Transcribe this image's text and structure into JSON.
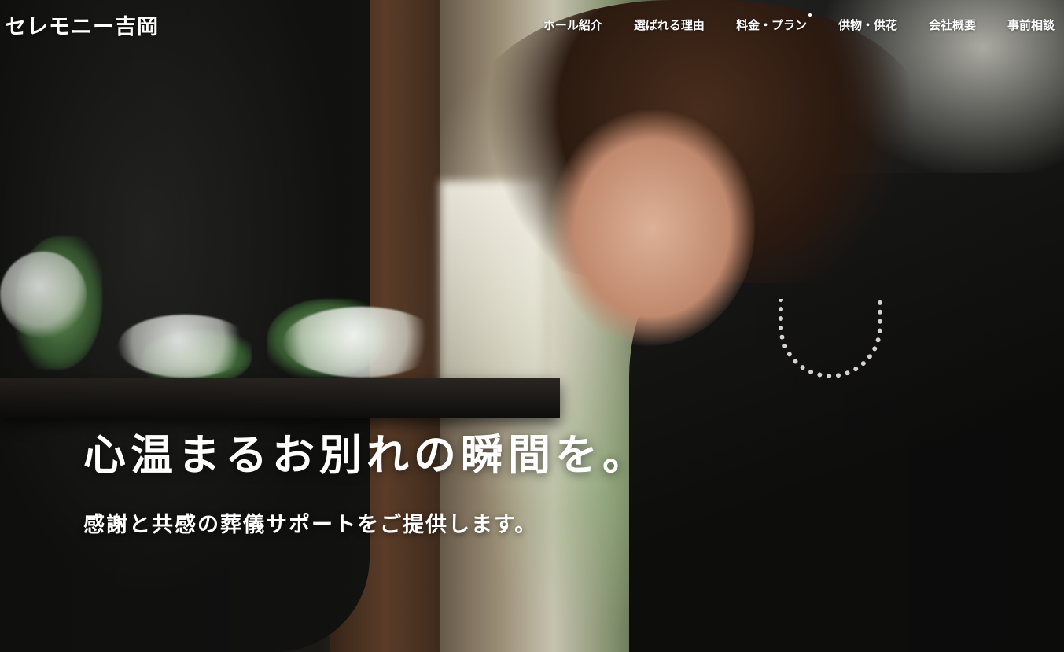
{
  "header": {
    "logo_text": "セレモニー吉岡"
  },
  "nav": {
    "items": [
      {
        "label": "ホール紹介"
      },
      {
        "label": "選ばれる理由"
      },
      {
        "label": "料金・プラン"
      },
      {
        "label": "供物・供花"
      },
      {
        "label": "会社概要"
      },
      {
        "label": "事前相談"
      }
    ]
  },
  "hero": {
    "headline": "心温まるお別れの瞬間を。",
    "subline": "感謝と共感の葬儀サポートをご提供します。"
  }
}
